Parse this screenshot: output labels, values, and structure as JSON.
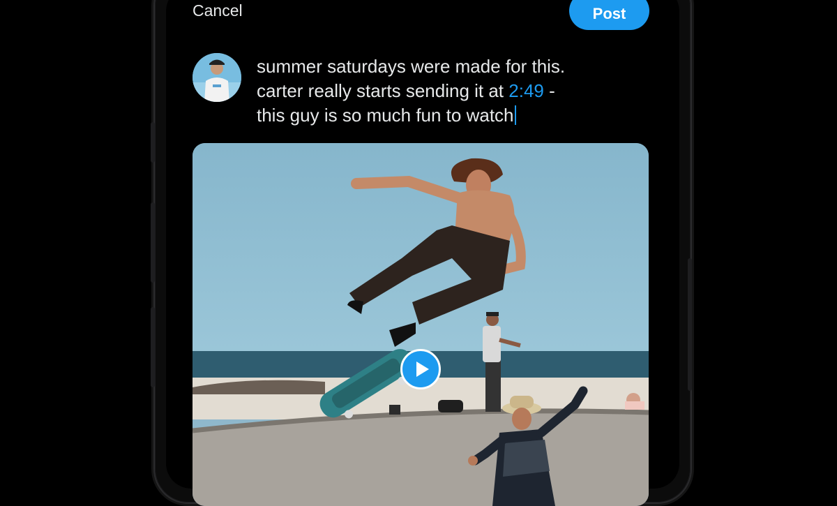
{
  "header": {
    "cancel_label": "Cancel",
    "post_label": "Post"
  },
  "composer": {
    "line1": "summer saturdays were made for this.",
    "line2_before": "carter really starts sending it at ",
    "timestamp": "2:49",
    "line2_after": " -",
    "line3": "this guy is so much fun to watch"
  },
  "media": {
    "type": "video",
    "play_icon": "play-icon"
  },
  "colors": {
    "accent": "#1d9bf0",
    "text": "#e7e9ea",
    "background": "#000000"
  }
}
